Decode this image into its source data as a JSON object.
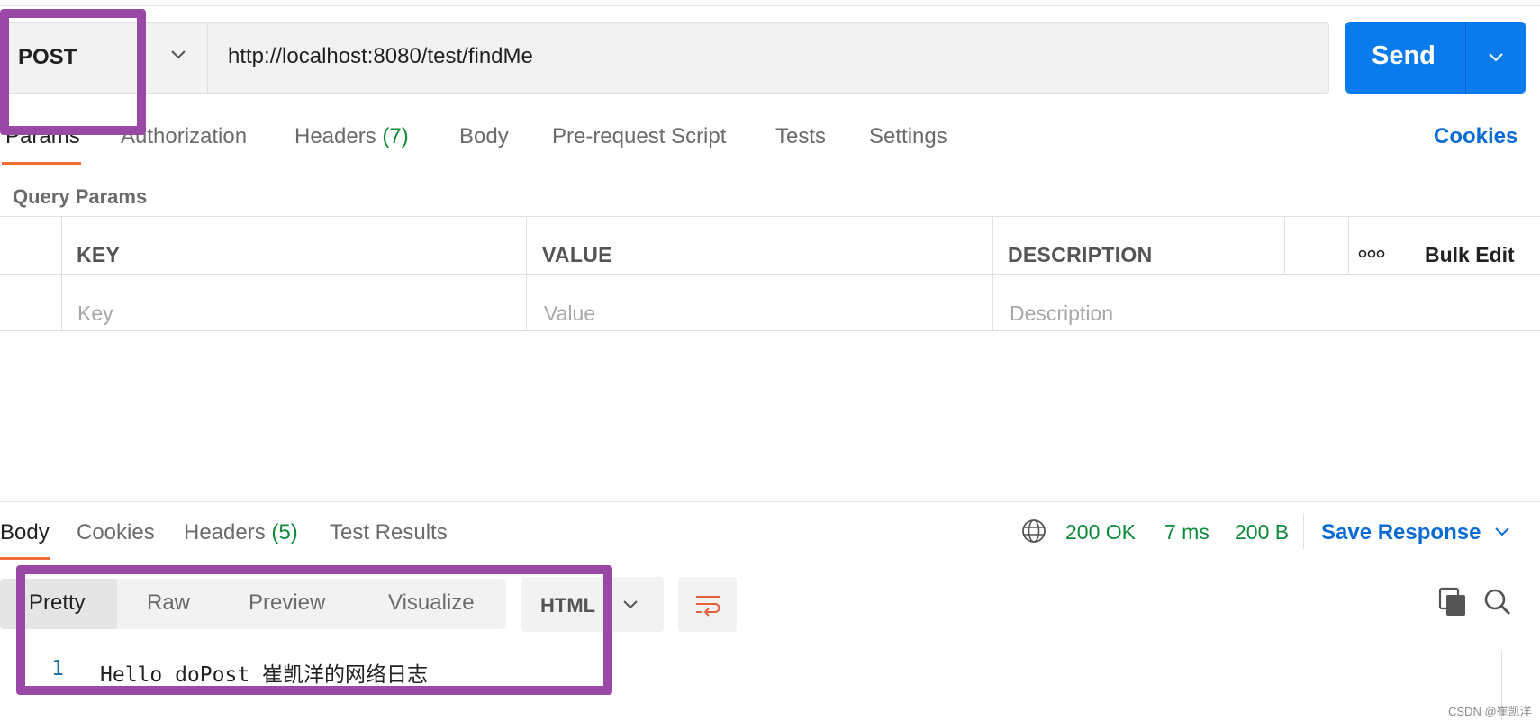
{
  "request": {
    "method": "POST",
    "url": "http://localhost:8080/test/findMe",
    "send_label": "Send"
  },
  "request_tabs": [
    {
      "label": "Params",
      "active": true
    },
    {
      "label": "Authorization"
    },
    {
      "label": "Headers",
      "count": "(7)"
    },
    {
      "label": "Body"
    },
    {
      "label": "Pre-request Script"
    },
    {
      "label": "Tests"
    },
    {
      "label": "Settings"
    }
  ],
  "cookies_label": "Cookies",
  "query_params": {
    "title": "Query Params",
    "columns": [
      "KEY",
      "VALUE",
      "DESCRIPTION"
    ],
    "bulk_edit_label": "Bulk Edit",
    "placeholders": [
      "Key",
      "Value",
      "Description"
    ]
  },
  "response": {
    "tabs": [
      {
        "label": "Body",
        "active": true
      },
      {
        "label": "Cookies"
      },
      {
        "label": "Headers",
        "count": "(5)"
      },
      {
        "label": "Test Results"
      }
    ],
    "status": "200 OK",
    "time": "7 ms",
    "size": "200 B",
    "save_label": "Save Response",
    "format_tabs": [
      "Pretty",
      "Raw",
      "Preview",
      "Visualize"
    ],
    "language": "HTML",
    "lines": [
      {
        "number": "1",
        "text": "Hello doPost 崔凯洋的网络日志"
      }
    ]
  },
  "watermark": "CSDN @崔凯洋",
  "colors": {
    "accent_blue": "#097bed",
    "link_blue": "#0b6bd6",
    "status_green": "#0f8a3a",
    "tab_underline": "#f26b3a",
    "annotation_purple": "#9a48a6"
  },
  "icons": [
    "chevron-down-icon",
    "globe-icon",
    "wrap-lines-icon",
    "copy-icon",
    "search-icon",
    "more-options-icon"
  ]
}
